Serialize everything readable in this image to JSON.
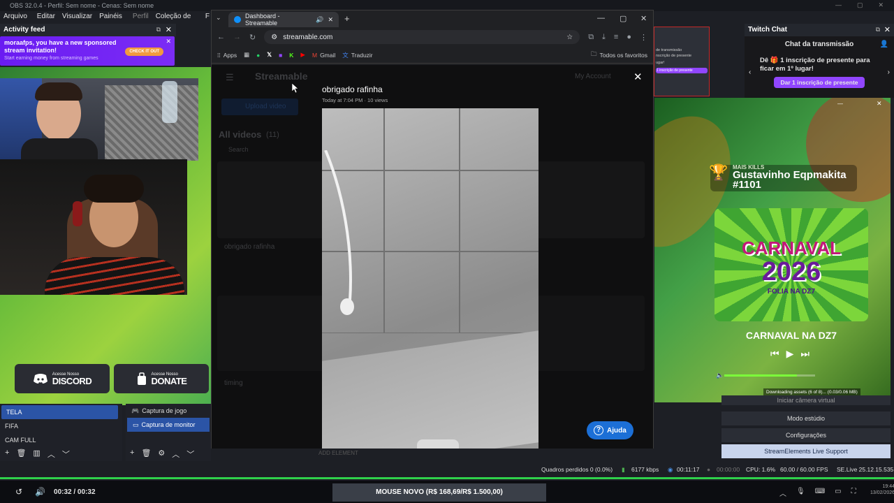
{
  "obs": {
    "title": "OBS 32.0.4 - Perfil: Sem nome - Cenas: Sem nome",
    "menu": [
      "Arquivo (F)",
      "Editar",
      "Visualizar",
      "Painéis (D)",
      "Perfil",
      "Coleção de cenas",
      "F"
    ],
    "activity_feed": {
      "title": "Activity feed",
      "sponsor_title": "moraafps, you have a new sponsored stream invitation!",
      "sponsor_sub": "Start earning money from streaming games",
      "sponsor_button": "CHECK IT OUT"
    },
    "discord": {
      "small": "Acesse Nosso",
      "big": "DISCORD"
    },
    "donate": {
      "small": "Acesse Nosso",
      "big": "DONATE"
    },
    "scenes": [
      "TELA",
      "FIFA",
      "CAM FULL"
    ],
    "sources": [
      "Captura de jogo",
      "Captura de monitor"
    ],
    "add_element": "ADD ELEMENT",
    "controls": [
      "Iniciar câmera virtual",
      "Modo estúdio",
      "Configurações",
      "StreamElements Live Support"
    ],
    "status": {
      "frames": "Quadros perdidos 0 (0.0%)",
      "kbps": "6177 kbps",
      "live_time": "00:11:17",
      "rec_time": "00:00:00",
      "cpu": "CPU: 1.6%",
      "fps": "60.00 / 60.00 FPS",
      "se": "SE.Live 25.12.15.535"
    }
  },
  "browser": {
    "tab_title": "Dashboard - Streamable",
    "url": "streamable.com",
    "bookmarks": [
      "Apps",
      "Gmail",
      "Traduzir"
    ],
    "all_bookmarks": "Todos os favoritos",
    "page": {
      "logo": "Streamable",
      "my_account": "My Account",
      "upload": "Upload video",
      "all_videos": "All videos",
      "all_videos_count": "(11)",
      "search": "Search",
      "video_title": "obrigado rafinha",
      "video_meta": "Today at 7:04 PM · 10 views",
      "help": "Ajuda",
      "bg_item1": "obrigado rafinha",
      "bg_item2": "timing"
    }
  },
  "twitch": {
    "title": "Twitch Chat",
    "header": "Chat da transmissão",
    "promo_line1": "Dê 🎁 1 inscrição de presente para",
    "promo_line2": "ficar em 1º lugar!",
    "promo_button": "Dar 1 inscrição de presente"
  },
  "overlay": {
    "kills_label": "MAIS KILLS",
    "kills_name": "Gustavinho Eqpmakita",
    "kills_id": "#1101",
    "carnaval_line1": "CARNAVAL",
    "carnaval_line2": "2026",
    "carnaval_line3": "FOLIA NA DZ7",
    "track": "CARNAVAL NA DZ7",
    "download": "Downloading assets (6 of 8)... (0.03/0.06 MB)",
    "volume_level": 0.8
  },
  "mini_twitch": {
    "l1": "de transmissão",
    "l2": "nscrição de presente",
    "l3": "ugar!",
    "l4": "1 inscrição de presente"
  },
  "player": {
    "time": "00:32 / 00:32",
    "ticker": "MOUSE NOVO (R$ 168,69/R$ 1.500,00)",
    "clock": "19:44",
    "date": "13/02/2026"
  }
}
